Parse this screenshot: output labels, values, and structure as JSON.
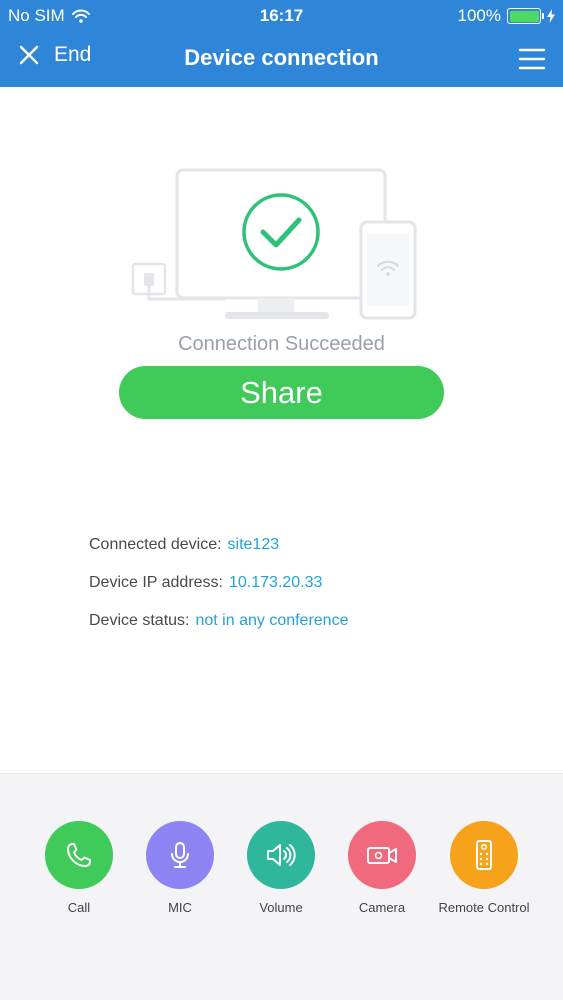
{
  "status_bar": {
    "carrier": "No SIM",
    "time": "16:17",
    "battery": "100%",
    "battery_level": 1.0
  },
  "nav": {
    "end_label": "End",
    "title": "Device connection"
  },
  "main": {
    "connection_text": "Connection Succeeded",
    "share_label": "Share",
    "info": [
      {
        "label": "Connected device:",
        "value": "site123"
      },
      {
        "label": "Device IP address:",
        "value": "10.173.20.33"
      },
      {
        "label": "Device status:",
        "value": "not in any conference"
      }
    ]
  },
  "toolbar": [
    {
      "label": "Call",
      "icon": "phone-icon",
      "color": "#3fca5a"
    },
    {
      "label": "MIC",
      "icon": "microphone-icon",
      "color": "#8c84f2"
    },
    {
      "label": "Volume",
      "icon": "speaker-icon",
      "color": "#2fb79b"
    },
    {
      "label": "Camera",
      "icon": "video-camera-icon",
      "color": "#f0697d"
    },
    {
      "label": "Remote Control",
      "icon": "remote-control-icon",
      "color": "#f7a21b"
    }
  ],
  "colors": {
    "header": "#2f86d8",
    "accent_green": "#3fca5a",
    "link": "#22a3d4"
  }
}
